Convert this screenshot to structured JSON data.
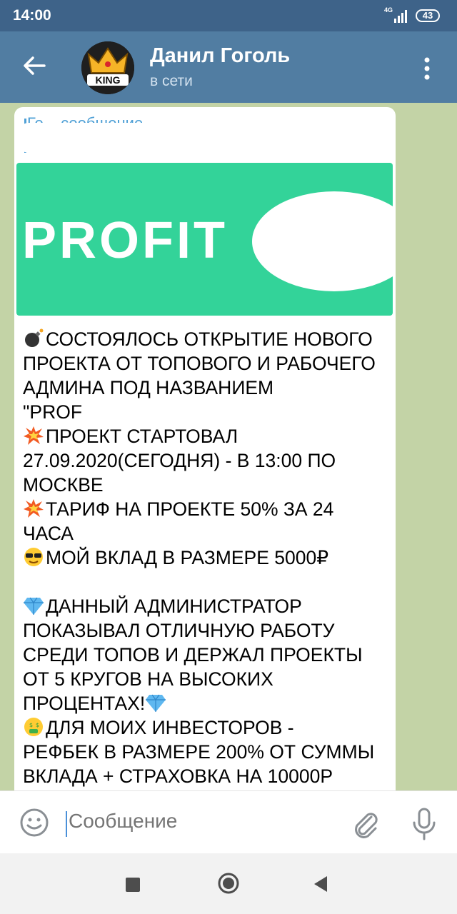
{
  "status_bar": {
    "time": "14:00",
    "network": "4G",
    "battery": "43"
  },
  "header": {
    "name": "Данил Гоголь",
    "status": "в сети",
    "avatar_text": "KING"
  },
  "message": {
    "reply_title": "Го... сообщение",
    "banner_text": "PROFIT",
    "lines": [
      {
        "emoji": "bomb-icon",
        "text": "СОСТОЯЛОСЬ ОТКРЫТИЕ НОВОГО"
      },
      {
        "emoji": "",
        "text": "ПРОЕКТА ОТ ТОПОВОГО И РАБОЧЕГО"
      },
      {
        "emoji": "",
        "text": "АДМИНА ПОД НАЗВАНИЕМ"
      },
      {
        "emoji": "",
        "text": "\"PROF"
      },
      {
        "emoji": "collision-icon",
        "text": "ПРОЕКТ СТАРТОВАЛ"
      },
      {
        "emoji": "",
        "text": "27.09.2020(СЕГОДНЯ) - В 13:00 ПО"
      },
      {
        "emoji": "",
        "text": "МОСКВЕ"
      },
      {
        "emoji": "collision-icon",
        "text": "ТАРИФ НА ПРОЕКТЕ 50% ЗА 24"
      },
      {
        "emoji": "",
        "text": "ЧАСА"
      },
      {
        "emoji": "sunglasses-face-icon",
        "text": "МОЙ ВКЛАД В РАЗМЕРЕ 5000₽"
      },
      {
        "emoji": "",
        "text": ""
      },
      {
        "emoji": "gem-icon",
        "text": "ДАННЫЙ АДМИНИСТРАТОР"
      },
      {
        "emoji": "",
        "text": "ПОКАЗЫВАЛ ОТЛИЧНУЮ РАБОТУ"
      },
      {
        "emoji": "",
        "text": "СРЕДИ ТОПОВ И ДЕРЖАЛ ПРОЕКТЫ"
      },
      {
        "emoji": "",
        "text": "ОТ 5 КРУГОВ НА ВЫСОКИХ"
      },
      {
        "emoji": "",
        "text": "ПРОЦЕНТАХ!"
      },
      {
        "emoji": "money-mouth-face-icon",
        "text": "ДЛЯ МОИХ ИНВЕСТОРОВ -"
      },
      {
        "emoji": "",
        "text": "РЕФБЕК В РАЗМЕРЕ 200% ОТ СУММЫ"
      },
      {
        "emoji": "",
        "text": "ВКЛАДА + СТРАХОВКА НА 10000Р"
      }
    ]
  },
  "input": {
    "placeholder": "Сообщение"
  },
  "colors": {
    "header": "#517da2",
    "status_bar": "#3e6389",
    "banner": "#33d399",
    "link": "#4fa0d6"
  }
}
